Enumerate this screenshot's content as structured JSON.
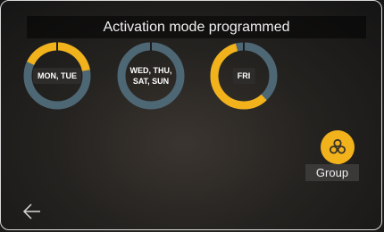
{
  "header": {
    "title": "Activation mode programmed"
  },
  "colors": {
    "active": "#f2b21b",
    "inactive": "#4e6775",
    "gap": "#1c1c1c"
  },
  "programs": [
    {
      "label": "MON, TUE",
      "active_fraction": 0.4,
      "active_start": 0.82,
      "style": "box"
    },
    {
      "label": "WED, THU, SAT, SUN",
      "active_fraction": 0.0,
      "active_start": 0.0,
      "style": "plain"
    },
    {
      "label": "FRI",
      "active_fraction": 0.58,
      "active_start": 0.38,
      "style": "box"
    }
  ],
  "group": {
    "label": "Group",
    "icon": "group-icon"
  },
  "nav": {
    "back_icon": "back-arrow-icon"
  }
}
